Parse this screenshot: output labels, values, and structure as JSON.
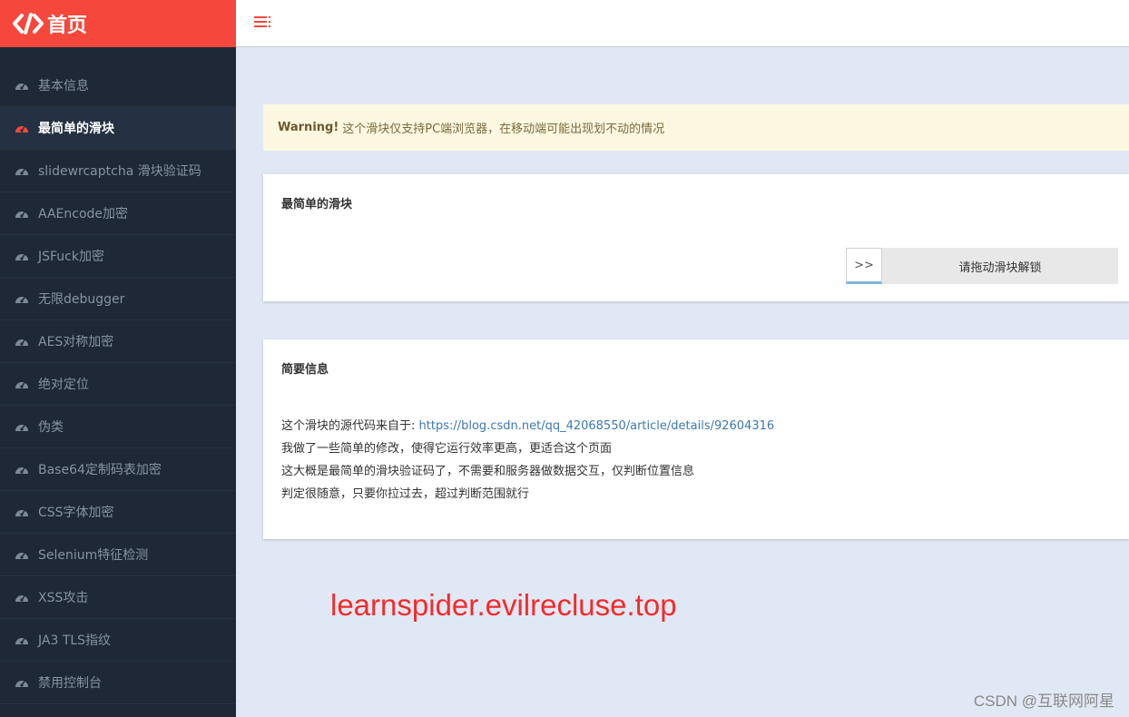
{
  "app": {
    "title": "首页"
  },
  "sidebar": {
    "items": [
      {
        "label": "基本信息",
        "active": false
      },
      {
        "label": "最简单的滑块",
        "active": true
      },
      {
        "label": "slidewrcaptcha 滑块验证码",
        "active": false
      },
      {
        "label": "AAEncode加密",
        "active": false
      },
      {
        "label": "JSFuck加密",
        "active": false
      },
      {
        "label": "无限debugger",
        "active": false
      },
      {
        "label": "AES对称加密",
        "active": false
      },
      {
        "label": "绝对定位",
        "active": false
      },
      {
        "label": "伪类",
        "active": false
      },
      {
        "label": "Base64定制码表加密",
        "active": false
      },
      {
        "label": "CSS字体加密",
        "active": false
      },
      {
        "label": "Selenium特征检测",
        "active": false
      },
      {
        "label": "XSS攻击",
        "active": false
      },
      {
        "label": "JA3 TLS指纹",
        "active": false
      },
      {
        "label": "禁用控制台",
        "active": false
      }
    ]
  },
  "warning": {
    "strong": "Warning!",
    "text": "这个滑块仅支持PC端浏览器，在移动端可能出现划不动的情况"
  },
  "slider_card": {
    "title": "最简单的滑块",
    "handle_glyph": ">>",
    "slider_text": "请拖动滑块解锁"
  },
  "info_card": {
    "title": "简要信息",
    "source_prefix": "这个滑块的源代码来自于: ",
    "source_link": "https://blog.csdn.net/qq_42068550/article/details/92604316",
    "line2": "我做了一些简单的修改，使得它运行效率更高，更适合这个页面",
    "line3": "这大概是最简单的滑块验证码了，不需要和服务器做数据交互，仅判断位置信息",
    "line4": "判定很随意，只要你拉过去，超过判断范围就行"
  },
  "watermark": "learnspider.evilrecluse.top",
  "credit": "CSDN @互联网阿星",
  "colors": {
    "brand": "#f5473c",
    "sidebar_bg": "#1e2836",
    "content_bg": "#e1e8f5",
    "link": "#3c78b4"
  }
}
